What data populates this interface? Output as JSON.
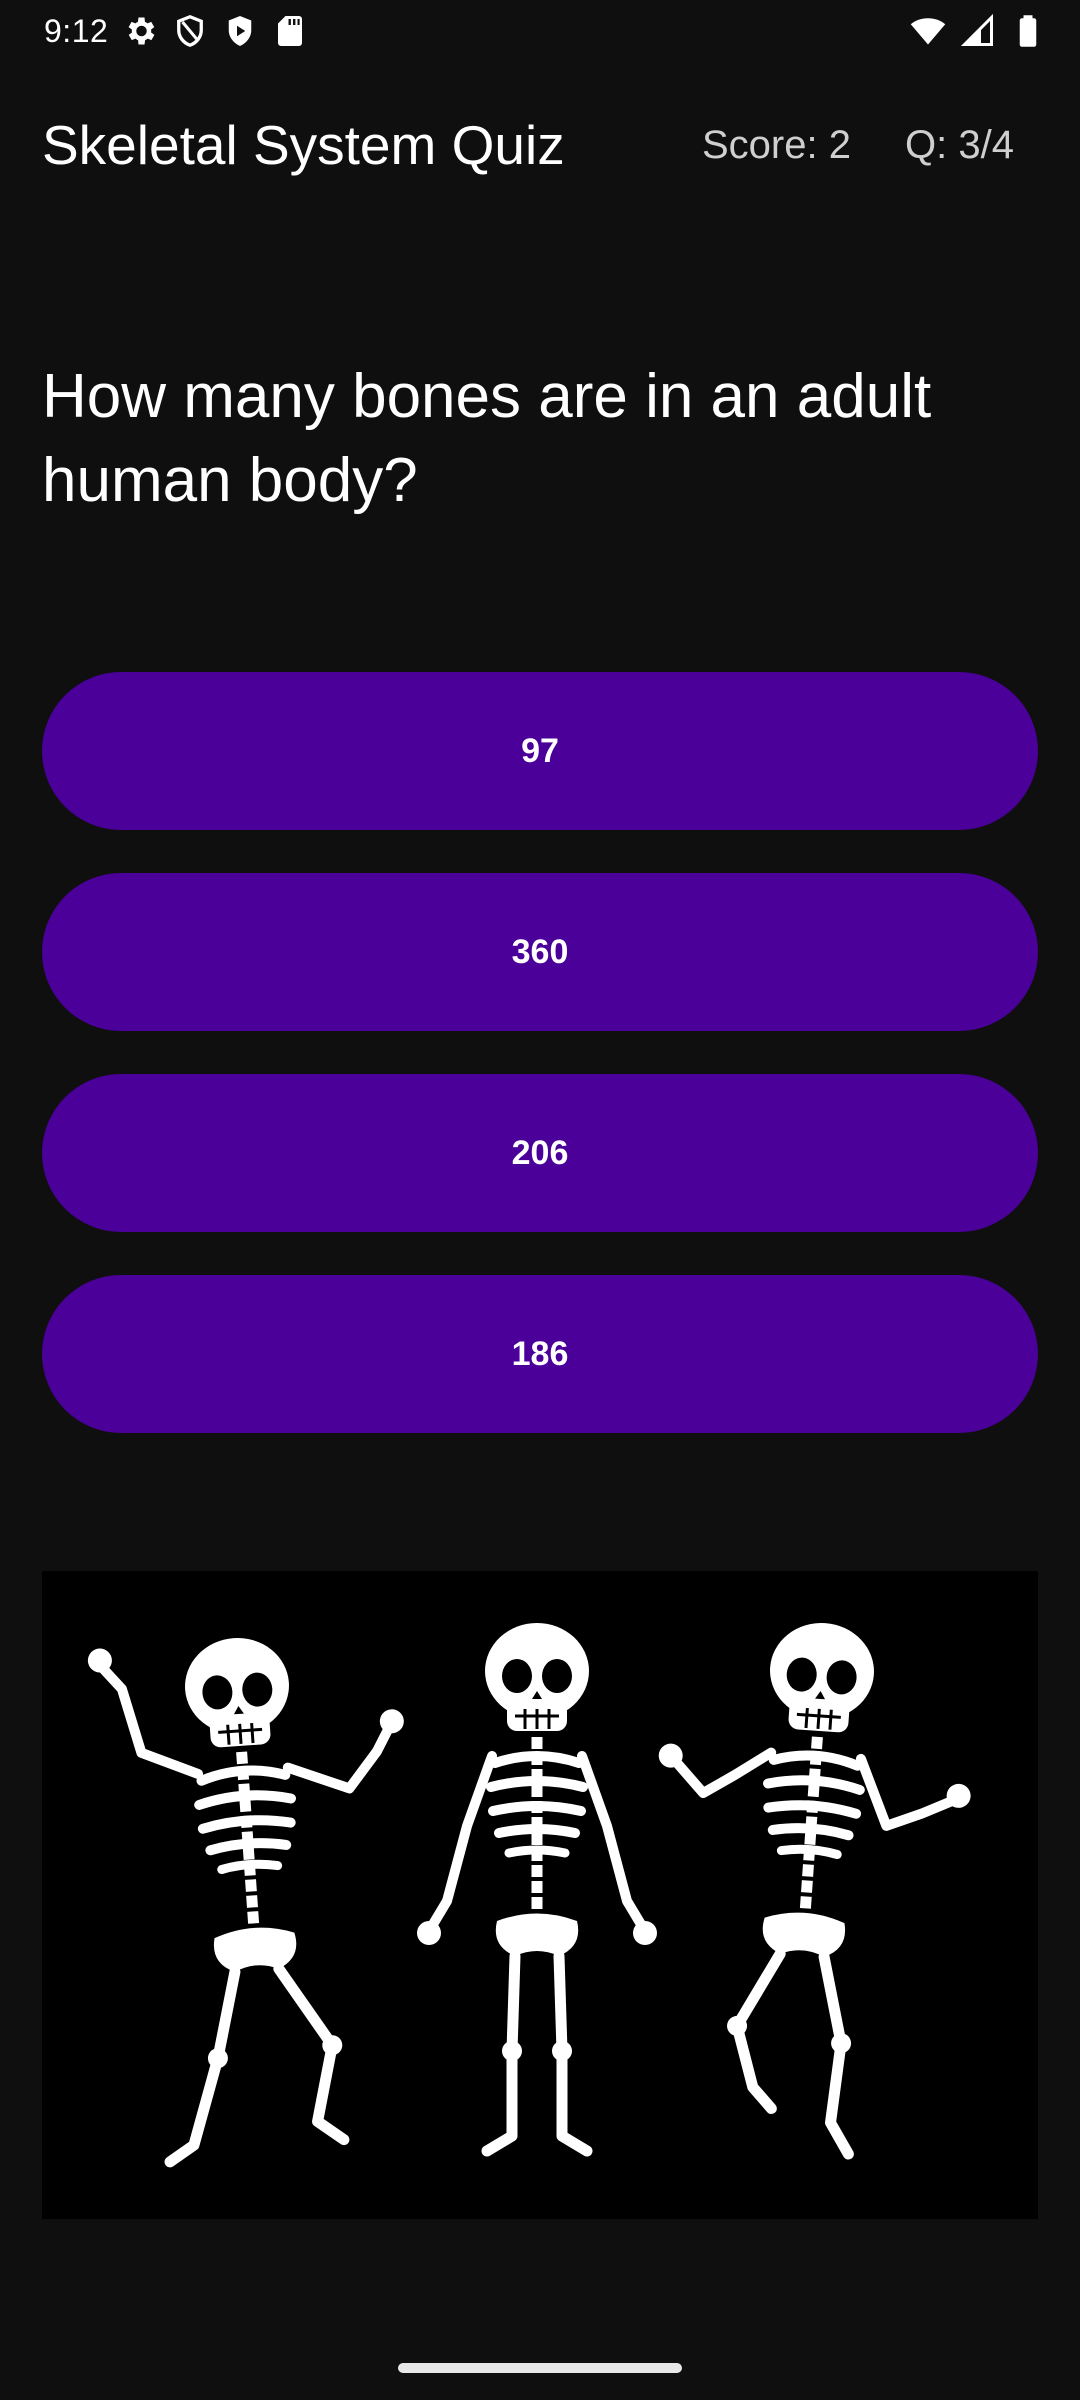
{
  "status_bar": {
    "time": "9:12",
    "left_icons": [
      "gear-icon",
      "shield-icon",
      "play-protect-icon",
      "sd-card-icon"
    ],
    "right_icons": [
      "wifi-icon",
      "signal-icon",
      "battery-icon"
    ]
  },
  "app_bar": {
    "title": "Skeletal System Quiz",
    "score": "Score: 2",
    "question_counter": "Q: 3/4"
  },
  "quiz": {
    "question": "How many bones are in an adult human body?",
    "answers": [
      "97",
      "360",
      "206",
      "186"
    ]
  },
  "illustration": {
    "subject": "three dancing skeletons",
    "background": "#000000"
  },
  "colors": {
    "background": "#0f0f0f",
    "button": "#4a0099",
    "text": "#ffffff",
    "secondary_text": "#cfcfcf"
  }
}
